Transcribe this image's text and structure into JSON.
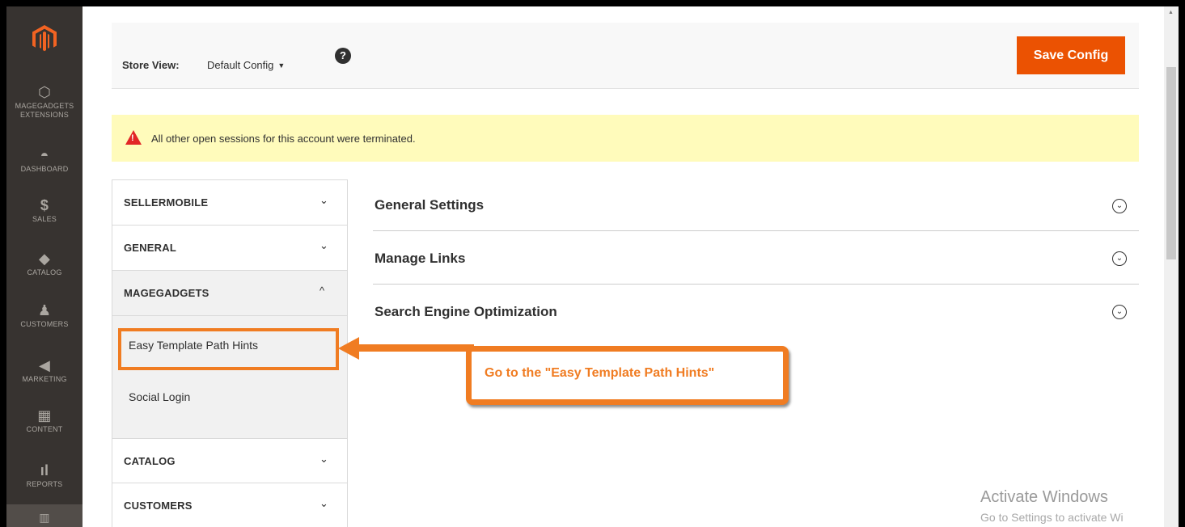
{
  "admin_nav": {
    "logo_icon": "magento-logo-icon",
    "items": [
      {
        "label": "MAGEGADGETS EXTENSIONS",
        "line1": "MAGEGADGETS",
        "line2": "EXTENSIONS",
        "icon": "hexagon-icon",
        "glyph": "⬡"
      },
      {
        "label": "DASHBOARD",
        "icon": "speedometer-icon",
        "glyph": "◓"
      },
      {
        "label": "SALES",
        "icon": "dollar-icon",
        "glyph": "$"
      },
      {
        "label": "CATALOG",
        "icon": "box-icon",
        "glyph": "◆"
      },
      {
        "label": "CUSTOMERS",
        "icon": "person-icon",
        "glyph": "♟"
      },
      {
        "label": "MARKETING",
        "icon": "megaphone-icon",
        "glyph": "◀"
      },
      {
        "label": "CONTENT",
        "icon": "layout-icon",
        "glyph": "▦"
      },
      {
        "label": "REPORTS",
        "icon": "bar-chart-icon",
        "glyph": "ıl"
      }
    ]
  },
  "header": {
    "store_view_label": "Store View:",
    "store_view_value": "Default Config",
    "help_glyph": "?",
    "save_label": "Save Config"
  },
  "message": {
    "text": "All other open sessions for this account were terminated."
  },
  "tabs": {
    "groups": [
      {
        "label": "SELLERMOBILE",
        "chevron": "⌄"
      },
      {
        "label": "GENERAL",
        "chevron": "⌄"
      },
      {
        "label": "MAGEGADGETS",
        "chevron": "^"
      },
      {
        "label": "CATALOG",
        "chevron": "⌄"
      },
      {
        "label": "CUSTOMERS",
        "chevron": "⌄"
      }
    ],
    "links": [
      {
        "label": "Easy Template Path Hints"
      },
      {
        "label": "Social Login"
      }
    ]
  },
  "sections": [
    {
      "title": "General Settings"
    },
    {
      "title": "Manage Links"
    },
    {
      "title": "Search Engine Optimization"
    }
  ],
  "annotation": {
    "callout_text": "Go to the \"Easy Template Path Hints\""
  },
  "watermark": {
    "line1": "Activate Windows",
    "line2": "Go to Settings to activate Wi"
  },
  "colors": {
    "accent": "#eb5202",
    "annotation": "#f07c22",
    "nav_bg": "#373330",
    "message_bg": "#fffbbb"
  }
}
